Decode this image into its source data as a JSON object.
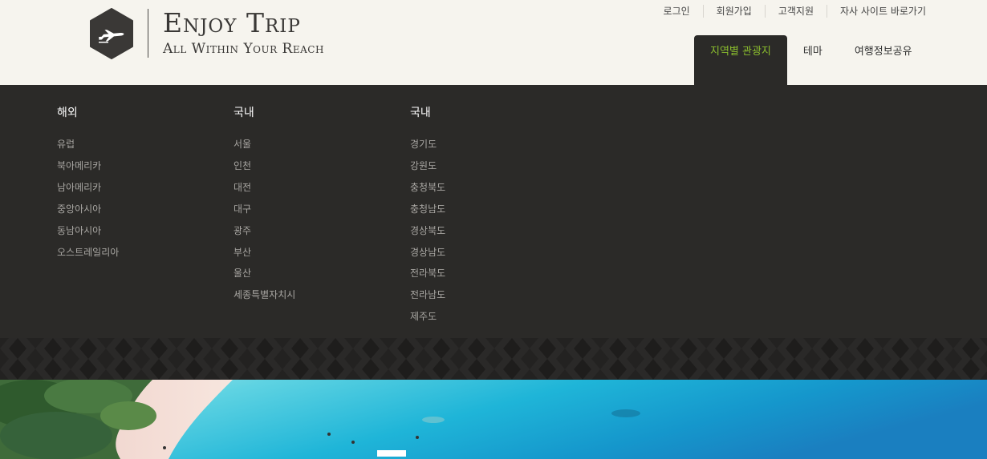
{
  "brand": {
    "title": "Enjoy Trip",
    "subtitle": "All Within Your Reach",
    "logo_icon": "airplane-icon"
  },
  "util_nav": [
    "로그인",
    "회원가입",
    "고객지원",
    "자사 사이트 바로가기"
  ],
  "main_nav": [
    {
      "label": "지역별 관광지",
      "active": true
    },
    {
      "label": "테마",
      "active": false
    },
    {
      "label": "여행정보공유",
      "active": false
    }
  ],
  "megamenu": {
    "columns": [
      {
        "heading": "해외",
        "items": [
          "유럽",
          "북아메리카",
          "남아메리카",
          "중앙아시아",
          "동남아시아",
          "오스트레일리아"
        ]
      },
      {
        "heading": "국내",
        "items": [
          "서울",
          "인천",
          "대전",
          "대구",
          "광주",
          "부산",
          "울산",
          "세종특별자치시"
        ]
      },
      {
        "heading": "국내",
        "items": [
          "경기도",
          "강원도",
          "충청북도",
          "충청남도",
          "경상북도",
          "경상남도",
          "전라북도",
          "전라남도",
          "제주도"
        ]
      }
    ]
  },
  "colors": {
    "header_bg": "#f6f4ee",
    "menu_bg": "#2b2a28",
    "accent": "#8cbf2e",
    "logo_hex": "#3a3836"
  }
}
